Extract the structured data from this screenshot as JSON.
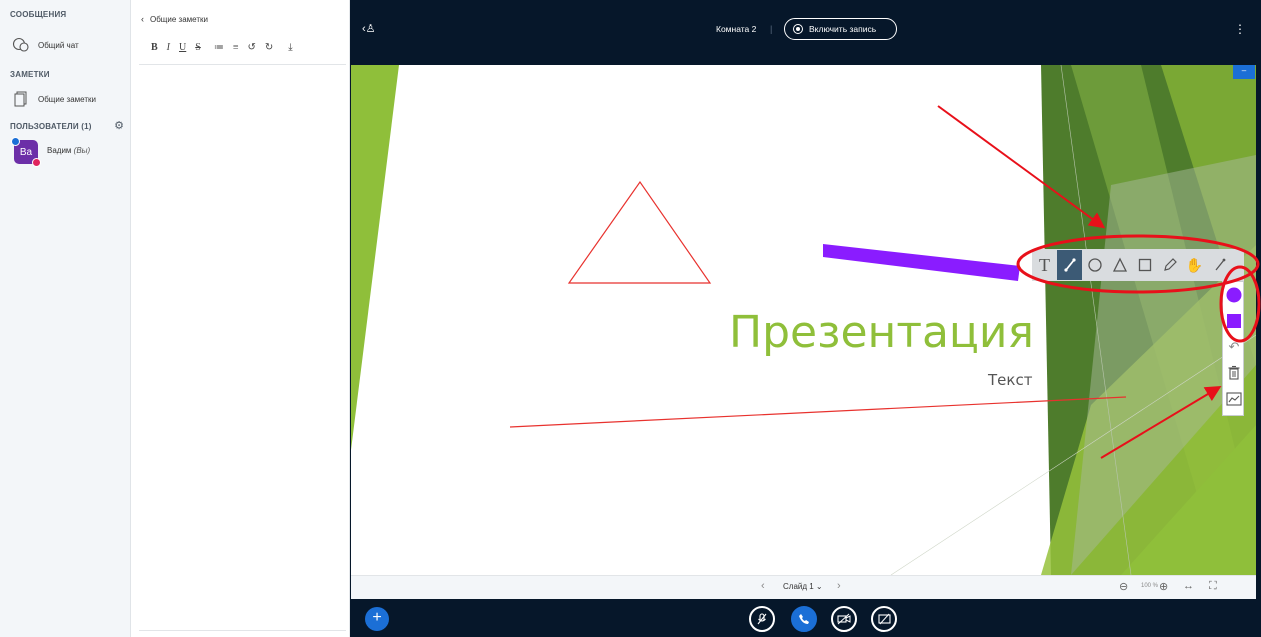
{
  "sidebar": {
    "messages_title": "СООБЩЕНИЯ",
    "public_chat": "Общий чат",
    "notes_title": "ЗАМЕТКИ",
    "shared_notes": "Общие заметки",
    "users_title": "ПОЛЬЗОВАТЕЛИ (1)",
    "user": {
      "initials": "Ва",
      "name": "Вадим",
      "you": "(Вы)"
    }
  },
  "notes_panel": {
    "back_label": "Общие заметки",
    "toolbar": [
      "B",
      "I",
      "U",
      "S",
      "≔",
      "≡",
      "↺",
      "↻",
      "⤓"
    ]
  },
  "topbar": {
    "room": "Комната 2",
    "record_label": "Включить запись"
  },
  "slide": {
    "title": "Презентация",
    "subtitle": "Текст",
    "minimize": "–"
  },
  "annotation": {
    "active_tool": "line",
    "color": "#8a2be2"
  },
  "slide_controls": {
    "slide_label": "Слайд 1",
    "zoom": "100 %"
  },
  "colors": {
    "navy": "#06172a",
    "accent": "#1b6fd6",
    "slide_title": "#8fbf3a"
  }
}
